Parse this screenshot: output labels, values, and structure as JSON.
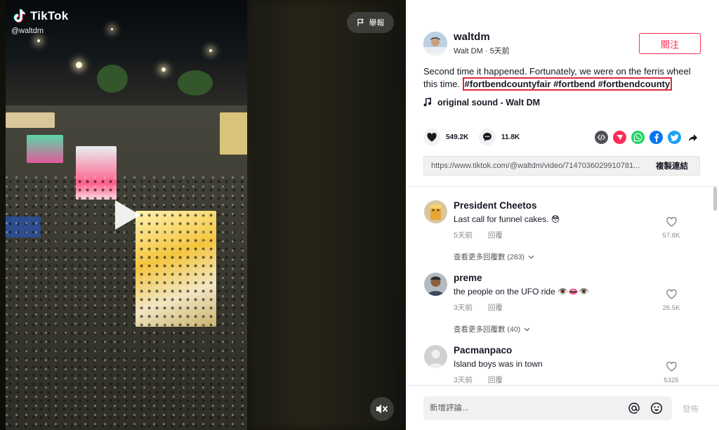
{
  "video": {
    "brand": "TikTok",
    "handle": "@waltdm",
    "report_label": "舉報"
  },
  "author": {
    "username": "waltdm",
    "display_name": "Walt DM",
    "time_ago": "5天前",
    "follow_label": "關注"
  },
  "caption": {
    "text": "Second time it happened. Fortunately, we were on the ferris wheel this time.",
    "hashtags": [
      "#fortbendcountyfair",
      "#fortbend",
      "#fortbendcounty"
    ]
  },
  "music": {
    "title": "original sound - Walt DM"
  },
  "stats": {
    "likes": "549.2K",
    "comments": "11.8K"
  },
  "share_link": {
    "url": "https://www.tiktok.com/@waltdm/video/7147036029910781...",
    "copy_label": "複製連結"
  },
  "comments": [
    {
      "name": "President Cheetos",
      "text": "Last call for funnel cakes. 😳",
      "time": "5天前",
      "reply": "回覆",
      "likes": "57.8K",
      "more": "查看更多回覆數 (283)"
    },
    {
      "name": "preme",
      "text": "the people on the UFO ride 👁️👄👁️",
      "time": "3天前",
      "reply": "回覆",
      "likes": "26.5K",
      "more": "查看更多回覆數 (40)"
    },
    {
      "name": "Pacmanpaco",
      "text": "Island boys was in town",
      "time": "3天前",
      "reply": "回覆",
      "likes": "5325",
      "more": ""
    }
  ],
  "composer": {
    "placeholder": "新增評論...",
    "post_label": "發佈"
  },
  "colors": {
    "accent": "#fe2c55",
    "highlight_box": "#e2263f",
    "panel_bg": "#ffffff",
    "input_bg": "#f1f1f2"
  },
  "icons": [
    "tiktok-logo-icon",
    "flag-icon",
    "play-icon",
    "muted-speaker-icon",
    "music-note-icon",
    "heart-icon",
    "comment-icon",
    "embed-icon",
    "send-icon",
    "whatsapp-icon",
    "facebook-icon",
    "twitter-icon",
    "share-arrow-icon",
    "at-icon",
    "emoji-icon",
    "chevron-down-icon"
  ]
}
